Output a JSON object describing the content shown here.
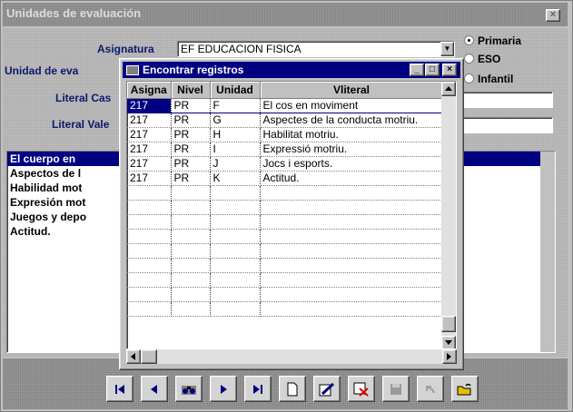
{
  "window": {
    "title": "Unidades de evaluación",
    "close_label": "×"
  },
  "form": {
    "asignatura_label": "Asignatura",
    "asignatura_value": "EF  EDUCACION FISICA",
    "unidad_label": "Unidad de eva",
    "literal_cast_label": "Literal Cas",
    "literal_val_label": "Literal Vale",
    "radios": [
      {
        "label": "Primaria",
        "selected": true
      },
      {
        "label": "ESO",
        "selected": false
      },
      {
        "label": "Infantil",
        "selected": false
      }
    ],
    "list_items": [
      "El cuerpo en",
      "Aspectos de l",
      "Habilidad mot",
      "Expresión mot",
      "Juegos y depo",
      "Actitud."
    ]
  },
  "dialog": {
    "title": "Encontrar registros",
    "columns": [
      "Asigna",
      "Nivel",
      "Unidad",
      "Vliteral"
    ],
    "rows": [
      [
        "217",
        "PR",
        "F",
        "El cos en moviment"
      ],
      [
        "217",
        "PR",
        "G",
        "Aspectes de la conducta motriu."
      ],
      [
        "217",
        "PR",
        "H",
        "Habilitat motriu."
      ],
      [
        "217",
        "PR",
        "I",
        "Expressió motriu."
      ],
      [
        "217",
        "PR",
        "J",
        "Jocs i esports."
      ],
      [
        "217",
        "PR",
        "K",
        "Actitud."
      ]
    ],
    "empty_rows": 9
  },
  "toolbar": {
    "buttons": [
      "first-record",
      "previous-record",
      "find-records",
      "next-record",
      "last-record",
      "new-record",
      "edit-record",
      "delete-record",
      "save-record",
      "undo",
      "open-folder"
    ]
  },
  "colors": {
    "selection": "#000080",
    "label_text": "#0a1a6e",
    "face": "#c0c0c0"
  }
}
